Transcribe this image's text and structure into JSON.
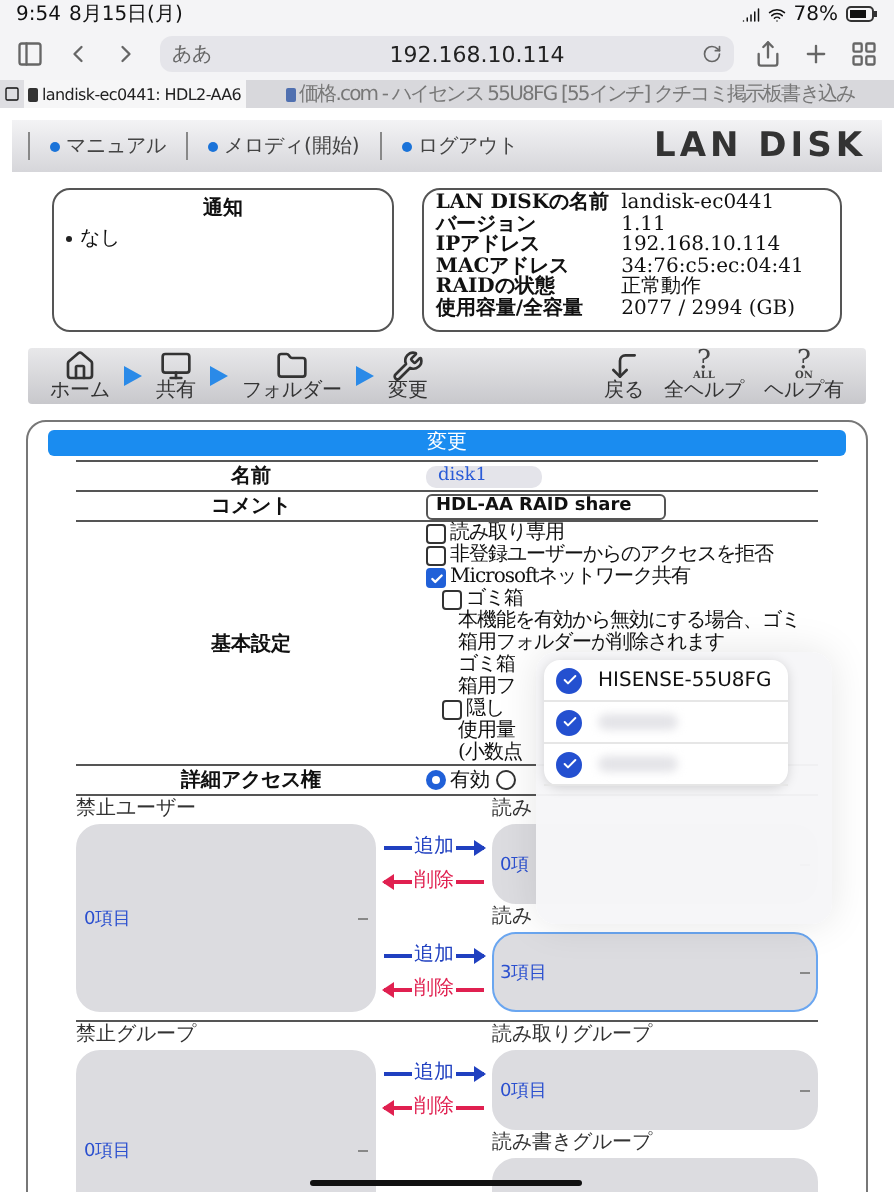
{
  "status_bar": {
    "time": "9:54",
    "date": "8月15日(月)",
    "battery": "78%"
  },
  "browser": {
    "text_size": "ああ",
    "url": "192.168.10.114"
  },
  "tabs": [
    {
      "label": "landisk-ec0441: HDL2-AA6",
      "selected": true
    },
    {
      "label": "価格.com - ハイセンス 55U8FG [55インチ] クチコミ掲示板書き込み",
      "selected": false
    }
  ],
  "header": {
    "links": [
      "マニュアル",
      "メロディ(開始)",
      "ログアウト"
    ],
    "logo": "LAN DISK"
  },
  "notice": {
    "title": "通知",
    "items": [
      "なし"
    ]
  },
  "info": [
    {
      "label": "LAN DISKの名前",
      "value": "landisk-ec0441"
    },
    {
      "label": "バージョン",
      "value": "1.11"
    },
    {
      "label": "IPアドレス",
      "value": "192.168.10.114"
    },
    {
      "label": "MACアドレス",
      "value": "34:76:c5:ec:04:41"
    },
    {
      "label": "RAIDの状態",
      "value": "正常動作"
    },
    {
      "label": "使用容量/全容量",
      "value": "2077 / 2994 (GB)"
    }
  ],
  "toolbar": {
    "crumbs": [
      {
        "label": "ホーム",
        "kind": "home"
      },
      {
        "label": "共有",
        "kind": "share"
      },
      {
        "label": "フォルダー",
        "kind": "folder"
      },
      {
        "label": "変更",
        "kind": "edit"
      }
    ],
    "actions": [
      {
        "label": "戻る",
        "kind": "back"
      },
      {
        "label": "全ヘルプ",
        "kind": "help",
        "mark": "?",
        "sub": "ALL"
      },
      {
        "label": "ヘルプ有",
        "kind": "help",
        "mark": "?",
        "sub": "ON"
      }
    ]
  },
  "form": {
    "title": "変更",
    "rows": [
      {
        "label": "名前",
        "kind": "select",
        "value": "disk1"
      },
      {
        "label": "コメント",
        "kind": "text",
        "value": "HDL-AA RAID share"
      },
      {
        "label": "基本設定",
        "kind": "options",
        "options": [
          {
            "kind": "checkbox",
            "label": "読み取り専用",
            "checked": false
          },
          {
            "kind": "checkbox",
            "label": "非登録ユーザーからのアクセスを拒否",
            "checked": false
          },
          {
            "kind": "checkbox",
            "label": "Microsoftネットワーク共有",
            "checked": true,
            "children": [
              {
                "kind": "checkbox",
                "label": "ゴミ箱",
                "checked": false,
                "children": [
                  {
                    "kind": "text",
                    "label": "本機能を有効から無効にする場合、ゴミ箱用フォルダーが削除されます"
                  },
                  {
                    "kind": "text",
                    "label": "ゴミ箱"
                  },
                  {
                    "kind": "text",
                    "label": "箱用フ"
                  }
                ]
              },
              {
                "kind": "checkbox",
                "label": "隠し",
                "checked": false,
                "children": [
                  {
                    "kind": "text",
                    "label": "使用量"
                  },
                  {
                    "kind": "text",
                    "label": "(小数点"
                  }
                ]
              }
            ]
          }
        ]
      },
      {
        "label": "詳細アクセス権",
        "kind": "radio",
        "options": [
          {
            "label": "有効",
            "selected": true
          },
          {
            "selected": false
          }
        ]
      }
    ]
  },
  "access": [
    {
      "left": {
        "title": "禁止ユーザー",
        "count": "0項目"
      },
      "right": [
        {
          "title": "読み",
          "count": "0項",
          "focused": false,
          "moves": [
            {
              "label": "追加",
              "kind": "add"
            },
            {
              "label": "削除",
              "kind": "remove"
            }
          ]
        },
        {
          "title": "読み",
          "count": "3項目",
          "focused": true,
          "moves": [
            {
              "label": "追加",
              "kind": "add"
            },
            {
              "label": "削除",
              "kind": "remove"
            }
          ]
        }
      ]
    },
    {
      "left": {
        "title": "禁止グループ",
        "count": "0項目"
      },
      "right": [
        {
          "title": "読み取りグループ",
          "count": "0項目",
          "focused": false,
          "moves": [
            {
              "label": "追加",
              "kind": "add"
            },
            {
              "label": "削除",
              "kind": "remove"
            }
          ]
        },
        {
          "title": "読み書きグループ",
          "focused": false
        }
      ]
    }
  ],
  "popup": {
    "items": [
      {
        "label": "HISENSE-55U8FG",
        "checked": true,
        "blurred": false
      },
      {
        "checked": true,
        "blurred": true
      },
      {
        "checked": true,
        "blurred": true
      }
    ]
  }
}
